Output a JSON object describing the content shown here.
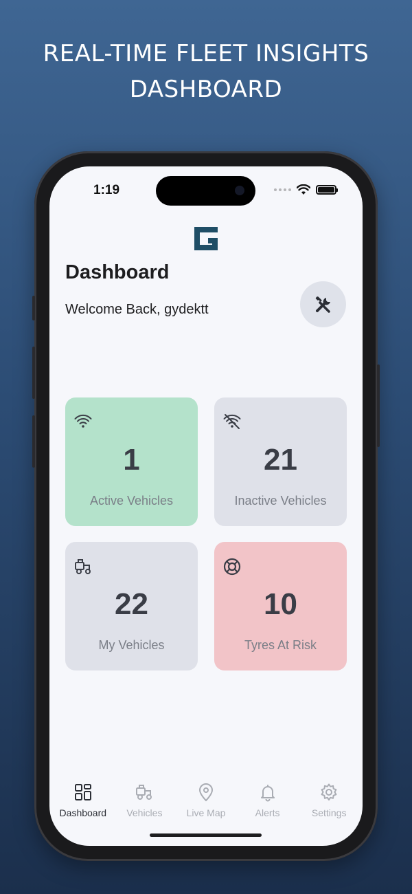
{
  "promo": {
    "line1": "REAL-TIME FLEET INSIGHTS",
    "line2": "DASHBOARD"
  },
  "status_bar": {
    "time": "1:19"
  },
  "header": {
    "title": "Dashboard",
    "welcome": "Welcome Back, gydektt",
    "tools_icon": "tools-icon",
    "logo_icon": "g-logo-icon"
  },
  "cards": [
    {
      "value": "1",
      "label": "Active Vehicles",
      "icon": "wifi-icon",
      "color": "#b4e2cb"
    },
    {
      "value": "21",
      "label": "Inactive Vehicles",
      "icon": "wifi-off-icon",
      "color": "#dfe1e9"
    },
    {
      "value": "22",
      "label": "My Vehicles",
      "icon": "tractor-icon",
      "color": "#dfe1e9"
    },
    {
      "value": "10",
      "label": "Tyres At Risk",
      "icon": "lifebuoy-icon",
      "color": "#f2c4c8"
    }
  ],
  "tabs": [
    {
      "label": "Dashboard",
      "icon": "grid-icon",
      "active": true
    },
    {
      "label": "Vehicles",
      "icon": "tractor-icon",
      "active": false
    },
    {
      "label": "Live Map",
      "icon": "map-pin-icon",
      "active": false
    },
    {
      "label": "Alerts",
      "icon": "bell-icon",
      "active": false
    },
    {
      "label": "Settings",
      "icon": "gear-icon",
      "active": false
    }
  ],
  "colors": {
    "accent_dark": "#1f4e66",
    "background_top": "#3f6693",
    "background_bottom": "#1b2f4c"
  }
}
